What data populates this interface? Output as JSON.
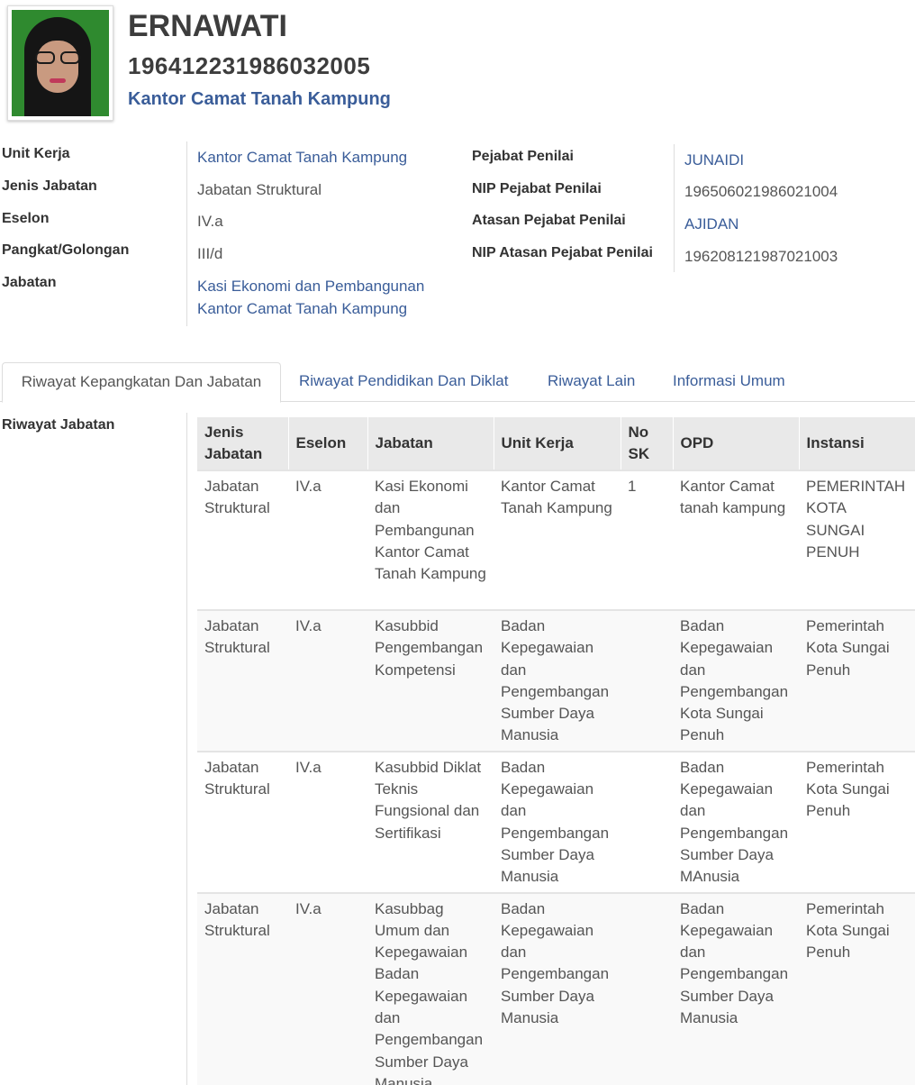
{
  "profile": {
    "name": "ERNAWATI",
    "nip": "196412231986032005",
    "unit": "Kantor Camat Tanah Kampung"
  },
  "details_left": [
    {
      "label": "Unit Kerja",
      "value": "Kantor Camat Tanah Kampung",
      "link": true
    },
    {
      "label": "Jenis Jabatan",
      "value": "Jabatan Struktural",
      "link": false
    },
    {
      "label": "Eselon",
      "value": "IV.a",
      "link": false
    },
    {
      "label": "Pangkat/Golongan",
      "value": "III/d",
      "link": false
    },
    {
      "label": "Jabatan",
      "value_line1": "Kasi Ekonomi dan Pembangunan",
      "value_line2": "Kantor Camat Tanah Kampung",
      "link": true
    }
  ],
  "details_right": [
    {
      "label": "Pejabat Penilai",
      "value": "JUNAIDI",
      "link": true
    },
    {
      "label": "NIP Pejabat Penilai",
      "value": "196506021986021004",
      "link": false
    },
    {
      "label": "Atasan Pejabat Penilai",
      "value": "AJIDAN",
      "link": true
    },
    {
      "label": "NIP Atasan Pejabat Penilai",
      "value": "196208121987021003",
      "link": false
    }
  ],
  "tabs": [
    {
      "label": "Riwayat Kepangkatan Dan Jabatan",
      "active": true
    },
    {
      "label": "Riwayat Pendidikan Dan Diklat",
      "active": false
    },
    {
      "label": "Riwayat Lain",
      "active": false
    },
    {
      "label": "Informasi Umum",
      "active": false
    }
  ],
  "section_label": "Riwayat Jabatan",
  "table": {
    "headers": [
      "Jenis Jabatan",
      "Eselon",
      "Jabatan",
      "Unit Kerja",
      "No SK",
      "OPD",
      "Instansi"
    ],
    "rows": [
      [
        "Jabatan Struktural",
        "IV.a",
        "Kasi Ekonomi dan Pembangunan Kantor Camat Tanah Kampung",
        "Kantor Camat Tanah Kampung",
        "1",
        "Kantor Camat tanah kampung",
        "PEMERINTAH KOTA SUNGAI PENUH"
      ],
      [
        "Jabatan Struktural",
        "IV.a",
        "Kasubbid Pengembangan Kompetensi",
        "Badan Kepegawaian dan Pengembangan Sumber Daya Manusia",
        "",
        "Badan Kepegawaian dan Pengembangan Kota Sungai Penuh",
        "Pemerintah Kota Sungai Penuh"
      ],
      [
        "Jabatan Struktural",
        "IV.a",
        "Kasubbid Diklat Teknis Fungsional dan Sertifikasi",
        "Badan Kepegawaian dan Pengembangan Sumber Daya Manusia",
        "",
        "Badan Kepegawaian dan Pengembangan Sumber Daya MAnusia",
        "Pemerintah Kota Sungai Penuh"
      ],
      [
        "Jabatan Struktural",
        "IV.a",
        "Kasubbag Umum dan Kepegawaian Badan Kepegawaian dan Pengembangan Sumber Daya Manusia",
        "Badan Kepegawaian dan Pengembangan Sumber Daya Manusia",
        "",
        "Badan Kepegawaian dan Pengembangan Sumber Daya Manusia",
        "Pemerintah Kota Sungai Penuh"
      ]
    ]
  }
}
